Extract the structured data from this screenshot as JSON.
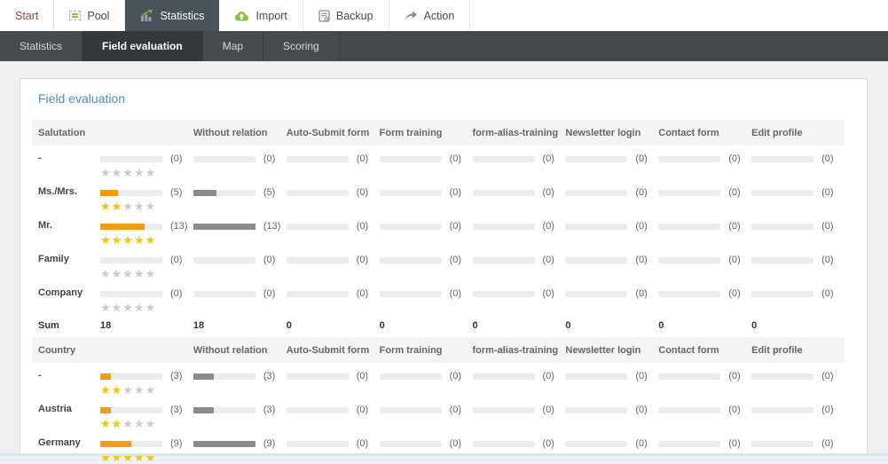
{
  "nav": {
    "items": [
      {
        "label": "Start",
        "icon": null,
        "style": "start",
        "active": false
      },
      {
        "label": "Pool",
        "icon": "pool-icon",
        "style": "",
        "active": false
      },
      {
        "label": "Statistics",
        "icon": "statistics-icon",
        "style": "",
        "active": true
      },
      {
        "label": "Import",
        "icon": "import-icon",
        "style": "",
        "active": false
      },
      {
        "label": "Backup",
        "icon": "backup-icon",
        "style": "",
        "active": false
      },
      {
        "label": "Action",
        "icon": "action-icon",
        "style": "",
        "active": false
      }
    ]
  },
  "subnav": {
    "items": [
      {
        "label": "Statistics",
        "active": false
      },
      {
        "label": "Field evaluation",
        "active": true
      },
      {
        "label": "Map",
        "active": false
      },
      {
        "label": "Scoring",
        "active": false
      }
    ]
  },
  "page": {
    "title": "Field evaluation"
  },
  "colors": {
    "accent_orange": "#f39c12",
    "bar_gray": "#8b8b8b",
    "star_yellow": "#f7c400",
    "star_empty": "#cbcbcb",
    "active_tab_bg": "#4a525a",
    "subnav_bg": "#43484d",
    "heading_blue": "#4a90c9",
    "start_red": "#9b4442"
  },
  "table": {
    "sections": [
      {
        "label": "Salutation",
        "columns": [
          "Without relation",
          "Auto-Submit form",
          "Form training",
          "form-alias-training",
          "Newsletter login",
          "Contact form",
          "Edit profile"
        ],
        "rows": [
          {
            "label": "-",
            "primary": {
              "count": "(0)",
              "pct": 0,
              "stars": 0
            },
            "cells": [
              {
                "count": "(0)",
                "pct": 0
              },
              {
                "count": "(0)",
                "pct": 0
              },
              {
                "count": "(0)",
                "pct": 0
              },
              {
                "count": "(0)",
                "pct": 0
              },
              {
                "count": "(0)",
                "pct": 0
              },
              {
                "count": "(0)",
                "pct": 0
              },
              {
                "count": "(0)",
                "pct": 0
              }
            ]
          },
          {
            "label": "Ms./Mrs.",
            "primary": {
              "count": "(5)",
              "pct": 28,
              "stars": 2
            },
            "cells": [
              {
                "count": "(5)",
                "pct": 38
              },
              {
                "count": "(0)",
                "pct": 0
              },
              {
                "count": "(0)",
                "pct": 0
              },
              {
                "count": "(0)",
                "pct": 0
              },
              {
                "count": "(0)",
                "pct": 0
              },
              {
                "count": "(0)",
                "pct": 0
              },
              {
                "count": "(0)",
                "pct": 0
              }
            ]
          },
          {
            "label": "Mr.",
            "primary": {
              "count": "(13)",
              "pct": 72,
              "stars": 5
            },
            "cells": [
              {
                "count": "(13)",
                "pct": 100
              },
              {
                "count": "(0)",
                "pct": 0
              },
              {
                "count": "(0)",
                "pct": 0
              },
              {
                "count": "(0)",
                "pct": 0
              },
              {
                "count": "(0)",
                "pct": 0
              },
              {
                "count": "(0)",
                "pct": 0
              },
              {
                "count": "(0)",
                "pct": 0
              }
            ]
          },
          {
            "label": "Family",
            "primary": {
              "count": "(0)",
              "pct": 0,
              "stars": 0
            },
            "cells": [
              {
                "count": "(0)",
                "pct": 0
              },
              {
                "count": "(0)",
                "pct": 0
              },
              {
                "count": "(0)",
                "pct": 0
              },
              {
                "count": "(0)",
                "pct": 0
              },
              {
                "count": "(0)",
                "pct": 0
              },
              {
                "count": "(0)",
                "pct": 0
              },
              {
                "count": "(0)",
                "pct": 0
              }
            ]
          },
          {
            "label": "Company",
            "primary": {
              "count": "(0)",
              "pct": 0,
              "stars": 0
            },
            "cells": [
              {
                "count": "(0)",
                "pct": 0
              },
              {
                "count": "(0)",
                "pct": 0
              },
              {
                "count": "(0)",
                "pct": 0
              },
              {
                "count": "(0)",
                "pct": 0
              },
              {
                "count": "(0)",
                "pct": 0
              },
              {
                "count": "(0)",
                "pct": 0
              },
              {
                "count": "(0)",
                "pct": 0
              }
            ]
          }
        ],
        "sum": {
          "label": "Sum",
          "values": [
            "18",
            "18",
            "0",
            "0",
            "0",
            "0",
            "0",
            "0"
          ]
        }
      },
      {
        "label": "Country",
        "columns": [
          "Without relation",
          "Auto-Submit form",
          "Form training",
          "form-alias-training",
          "Newsletter login",
          "Contact form",
          "Edit profile"
        ],
        "rows": [
          {
            "label": "-",
            "primary": {
              "count": "(3)",
              "pct": 17,
              "stars": 2
            },
            "cells": [
              {
                "count": "(3)",
                "pct": 33
              },
              {
                "count": "(0)",
                "pct": 0
              },
              {
                "count": "(0)",
                "pct": 0
              },
              {
                "count": "(0)",
                "pct": 0
              },
              {
                "count": "(0)",
                "pct": 0
              },
              {
                "count": "(0)",
                "pct": 0
              },
              {
                "count": "(0)",
                "pct": 0
              }
            ]
          },
          {
            "label": "Austria",
            "primary": {
              "count": "(3)",
              "pct": 17,
              "stars": 2
            },
            "cells": [
              {
                "count": "(3)",
                "pct": 33
              },
              {
                "count": "(0)",
                "pct": 0
              },
              {
                "count": "(0)",
                "pct": 0
              },
              {
                "count": "(0)",
                "pct": 0
              },
              {
                "count": "(0)",
                "pct": 0
              },
              {
                "count": "(0)",
                "pct": 0
              },
              {
                "count": "(0)",
                "pct": 0
              }
            ]
          },
          {
            "label": "Germany",
            "primary": {
              "count": "(9)",
              "pct": 50,
              "stars": 5
            },
            "cells": [
              {
                "count": "(9)",
                "pct": 100
              },
              {
                "count": "(0)",
                "pct": 0
              },
              {
                "count": "(0)",
                "pct": 0
              },
              {
                "count": "(0)",
                "pct": 0
              },
              {
                "count": "(0)",
                "pct": 0
              },
              {
                "count": "(0)",
                "pct": 0
              },
              {
                "count": "(0)",
                "pct": 0
              }
            ]
          }
        ],
        "sum": null
      }
    ]
  }
}
